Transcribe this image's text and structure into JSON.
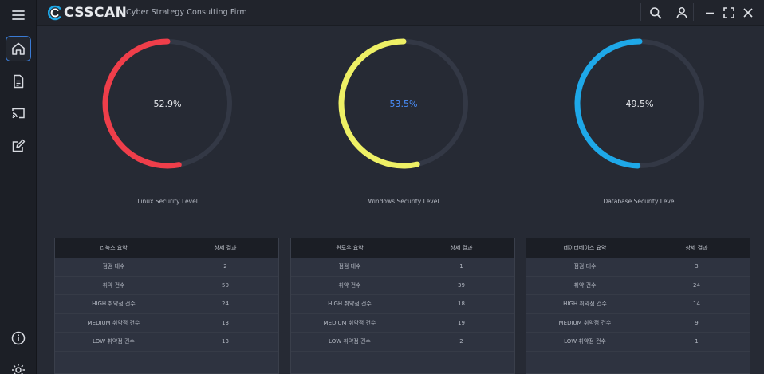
{
  "header": {
    "logo_text": "CSSCAN",
    "firm_name": "Cyber Strategy Consulting Firm"
  },
  "colors": {
    "linux": "#ef3e4a",
    "windows": "#eef065",
    "database": "#1ea8e8",
    "track": "#333845",
    "windows_value_text": "#4a90ff"
  },
  "gauges": [
    {
      "value": 52.9,
      "display": "52.9%",
      "label": "Linux Security Level"
    },
    {
      "value": 53.5,
      "display": "53.5%",
      "label": "Windows Security Level"
    },
    {
      "value": 49.5,
      "display": "49.5%",
      "label": "Database Security Level"
    }
  ],
  "tables": [
    {
      "col1": "리눅스 요약",
      "col2": "상세 결과",
      "rows": [
        {
          "k": "점검 대수",
          "v": "2"
        },
        {
          "k": "취약 건수",
          "v": "50"
        },
        {
          "k": "HIGH 취약점 건수",
          "v": "24"
        },
        {
          "k": "MEDIUM 취약점 건수",
          "v": "13"
        },
        {
          "k": "LOW 취약점 건수",
          "v": "13"
        }
      ]
    },
    {
      "col1": "윈도우 요약",
      "col2": "상세 결과",
      "rows": [
        {
          "k": "점검 대수",
          "v": "1"
        },
        {
          "k": "취약 건수",
          "v": "39"
        },
        {
          "k": "HIGH 취약점 건수",
          "v": "18"
        },
        {
          "k": "MEDIUM 취약점 건수",
          "v": "19"
        },
        {
          "k": "LOW 취약점 건수",
          "v": "2"
        }
      ]
    },
    {
      "col1": "데이터베이스 요약",
      "col2": "상세 결과",
      "rows": [
        {
          "k": "점검 대수",
          "v": "3"
        },
        {
          "k": "취약 건수",
          "v": "24"
        },
        {
          "k": "HIGH 취약점 건수",
          "v": "14"
        },
        {
          "k": "MEDIUM 취약점 건수",
          "v": "9"
        },
        {
          "k": "LOW 취약점 건수",
          "v": "1"
        }
      ]
    }
  ],
  "icons": {
    "sidebar": [
      "menu-icon",
      "home-icon",
      "document-icon",
      "cast-icon",
      "edit-icon",
      "info-icon",
      "settings-icon"
    ],
    "header": [
      "search-icon",
      "user-icon",
      "minimize-icon",
      "maximize-icon",
      "close-icon"
    ]
  }
}
